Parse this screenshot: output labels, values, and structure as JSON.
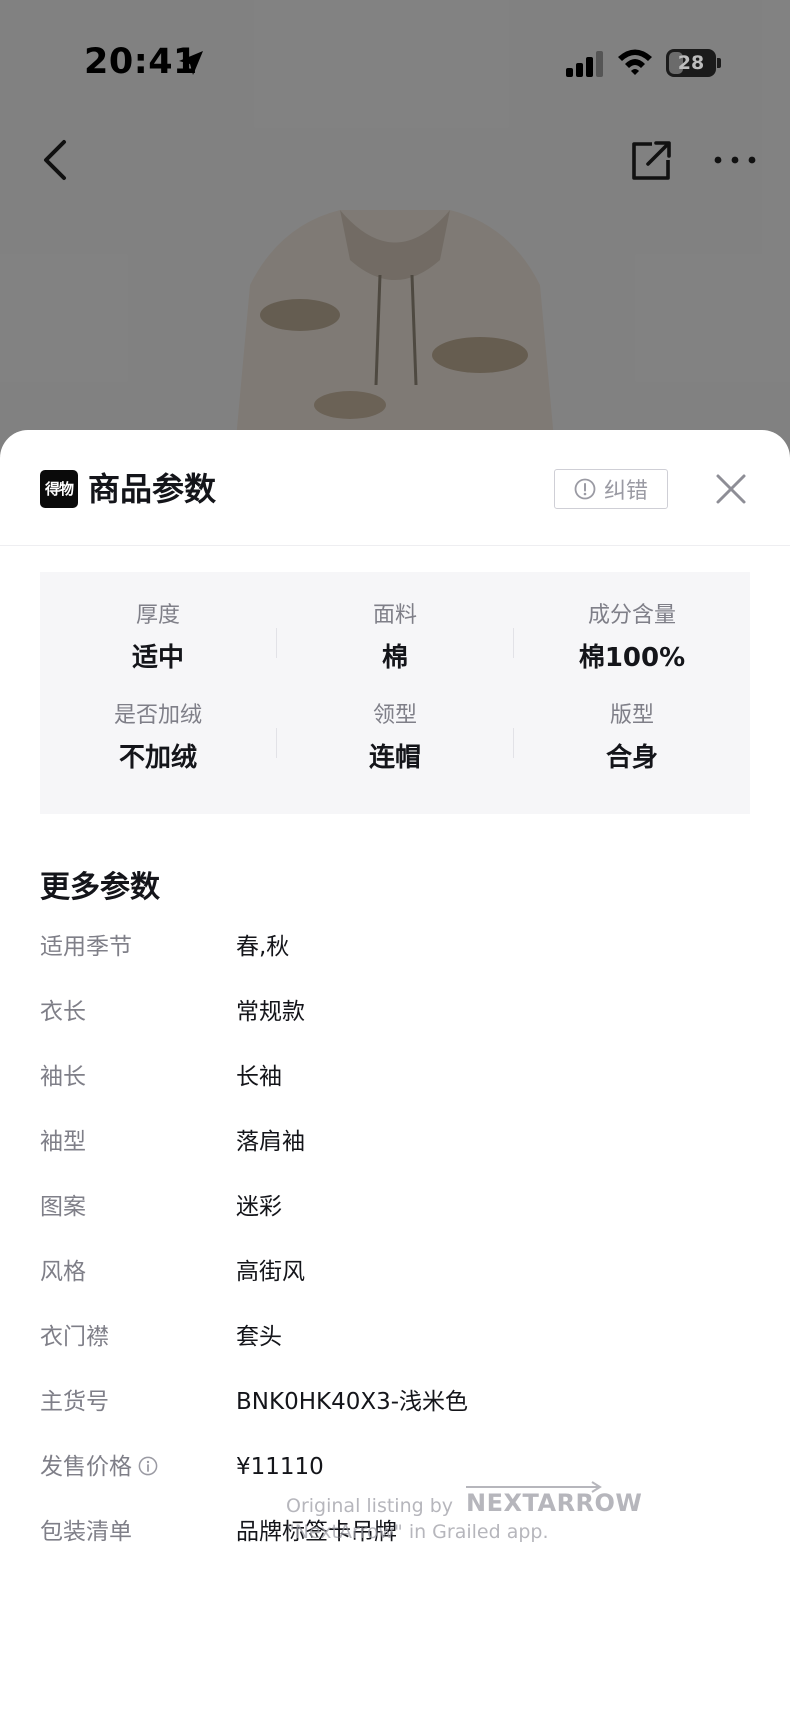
{
  "status_bar": {
    "time": "20:41",
    "battery": "28"
  },
  "sheet": {
    "title": "商品参数",
    "report_label": "纠错",
    "brand_logo_text": "得物"
  },
  "params": [
    {
      "label": "厚度",
      "value": "适中"
    },
    {
      "label": "面料",
      "value": "棉"
    },
    {
      "label": "成分含量",
      "value": "棉100%"
    },
    {
      "label": "是否加绒",
      "value": "不加绒"
    },
    {
      "label": "领型",
      "value": "连帽"
    },
    {
      "label": "版型",
      "value": "合身"
    }
  ],
  "more": {
    "title": "更多参数",
    "rows": [
      {
        "label": "适用季节",
        "value": "春,秋"
      },
      {
        "label": "衣长",
        "value": "常规款"
      },
      {
        "label": "袖长",
        "value": "长袖"
      },
      {
        "label": "袖型",
        "value": "落肩袖"
      },
      {
        "label": "图案",
        "value": "迷彩"
      },
      {
        "label": "风格",
        "value": "高街风"
      },
      {
        "label": "衣门襟",
        "value": "套头"
      },
      {
        "label": "主货号",
        "value": "BNK0HK40X3-浅米色"
      },
      {
        "label": "发售价格",
        "value": "¥11110"
      },
      {
        "label": "包装清单",
        "value": "品牌标签卡吊牌"
      }
    ]
  },
  "watermark": {
    "line1": "Original listing by",
    "brand": "NEXTARROW",
    "line2": "\"NextArrow\" in Grailed app."
  },
  "icons": {
    "back": "chevron-left-icon",
    "share": "share-external-icon",
    "more": "more-horizontal-icon",
    "close": "close-icon",
    "report": "alert-circle-icon",
    "info": "info-icon"
  }
}
